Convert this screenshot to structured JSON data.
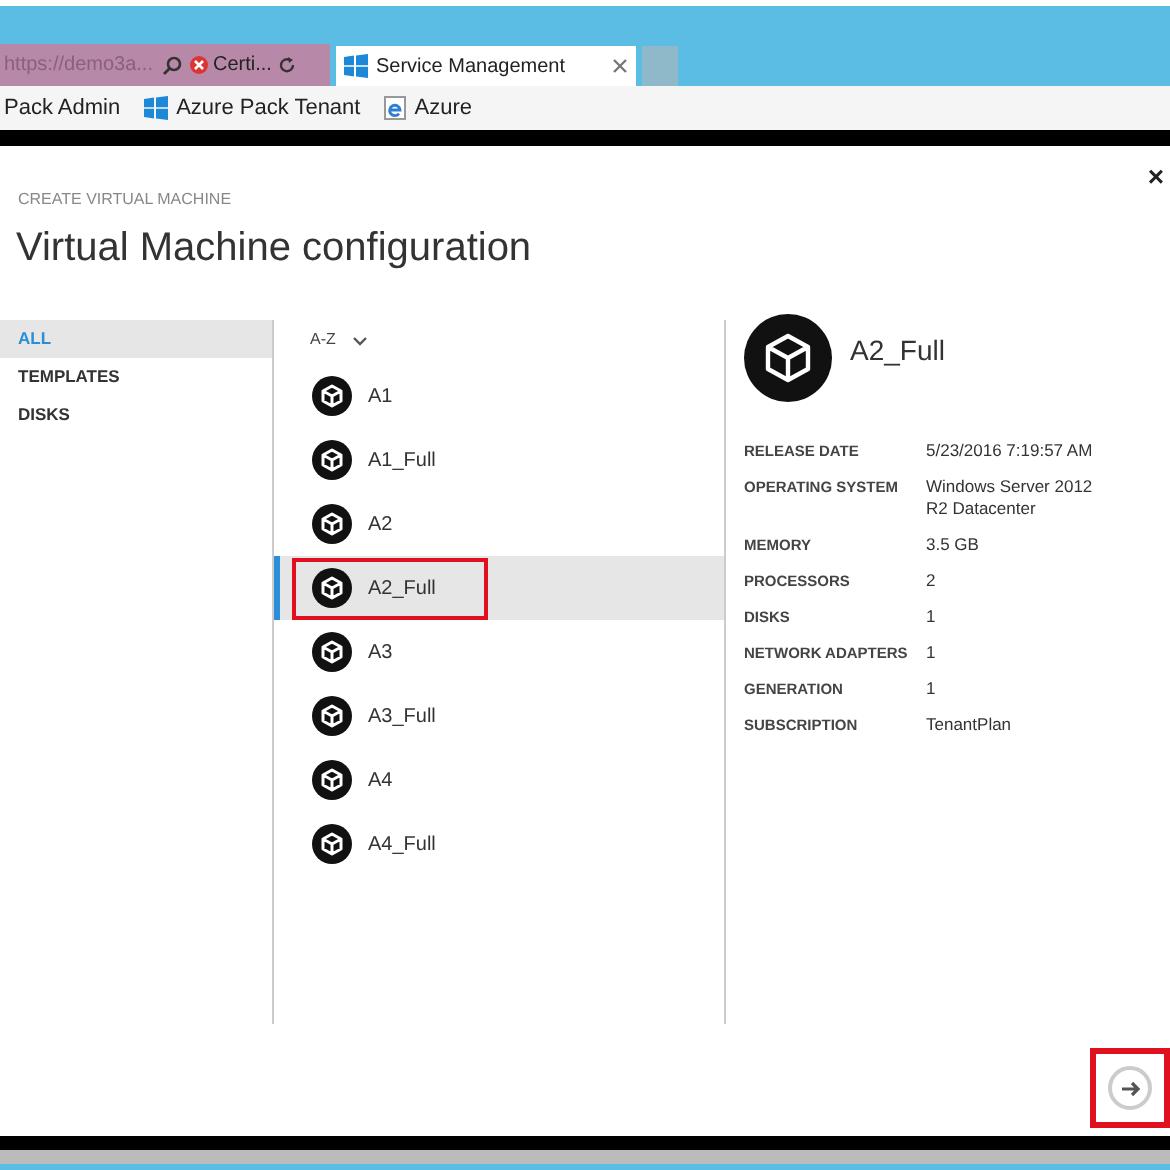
{
  "browser": {
    "address": "https://demo3a...",
    "tabs": [
      {
        "label": "Certi...",
        "kind": "error",
        "selected": false
      },
      {
        "label": "Service Management",
        "kind": "page",
        "selected": true
      }
    ],
    "favorites": [
      {
        "label": "Pack Admin",
        "kind": "plain"
      },
      {
        "label": "Azure Pack Tenant",
        "kind": "windows"
      },
      {
        "label": "Azure",
        "kind": "ie"
      }
    ]
  },
  "dialog": {
    "overline": "CREATE VIRTUAL MACHINE",
    "title": "Virtual Machine configuration",
    "close": "×",
    "nav": [
      {
        "label": "ALL",
        "selected": true
      },
      {
        "label": "TEMPLATES",
        "selected": false
      },
      {
        "label": "DISKS",
        "selected": false
      }
    ],
    "sort": "A-Z",
    "items": [
      {
        "label": "A1",
        "selected": false,
        "highlighted": false
      },
      {
        "label": "A1_Full",
        "selected": false,
        "highlighted": false
      },
      {
        "label": "A2",
        "selected": false,
        "highlighted": false
      },
      {
        "label": "A2_Full",
        "selected": true,
        "highlighted": true
      },
      {
        "label": "A3",
        "selected": false,
        "highlighted": false
      },
      {
        "label": "A3_Full",
        "selected": false,
        "highlighted": false
      },
      {
        "label": "A4",
        "selected": false,
        "highlighted": false
      },
      {
        "label": "A4_Full",
        "selected": false,
        "highlighted": false
      }
    ],
    "detail": {
      "name": "A2_Full",
      "properties": [
        {
          "label": "RELEASE DATE",
          "value": "5/23/2016 7:19:57 AM"
        },
        {
          "label": "OPERATING SYSTEM",
          "value": "Windows Server 2012 R2 Datacenter"
        },
        {
          "label": "MEMORY",
          "value": "3.5 GB"
        },
        {
          "label": "PROCESSORS",
          "value": "2"
        },
        {
          "label": "DISKS",
          "value": "1"
        },
        {
          "label": "NETWORK ADAPTERS",
          "value": "1"
        },
        {
          "label": "GENERATION",
          "value": "1"
        },
        {
          "label": "SUBSCRIPTION",
          "value": "TenantPlan"
        }
      ]
    },
    "next_highlighted": true
  }
}
